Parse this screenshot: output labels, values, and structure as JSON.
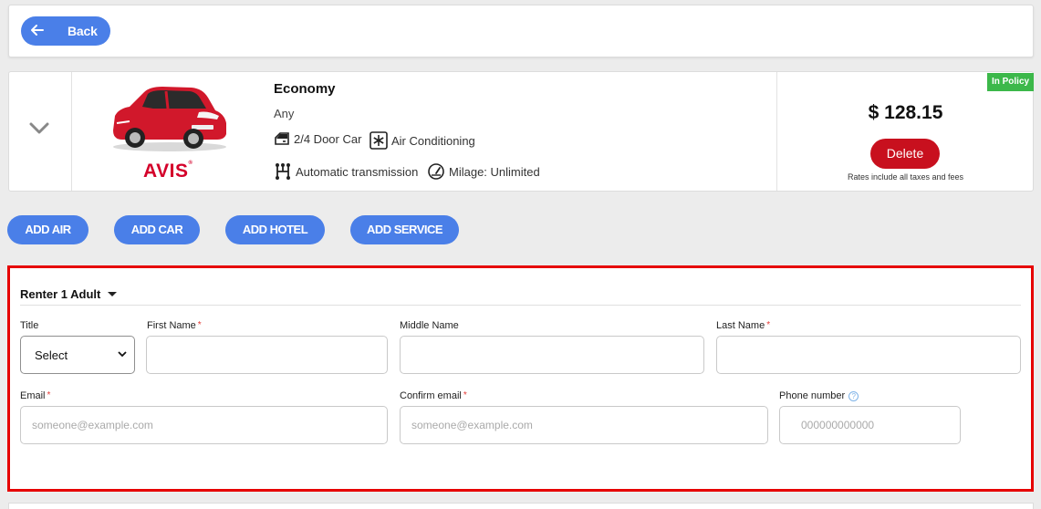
{
  "header": {
    "back_label": "Back"
  },
  "car": {
    "class": "Economy",
    "model": "Any",
    "vendor": "AVIS",
    "features": {
      "doors": "2/4 Door Car",
      "ac": "Air Conditioning",
      "transmission": "Automatic transmission",
      "mileage": "Milage: Unlimited"
    },
    "policy_badge": "In Policy",
    "price": "$ 128.15",
    "delete_label": "Delete",
    "fee_note": "Rates include all taxes and fees",
    "body_color": "#d1182b"
  },
  "add_buttons": {
    "air": "ADD AIR",
    "car": "ADD CAR",
    "hotel": "ADD HOTEL",
    "service": "ADD SERVICE"
  },
  "renter": {
    "title": "Renter 1 Adult",
    "fields": {
      "title_label": "Title",
      "title_value": "Select",
      "first_name_label": "First Name",
      "middle_name_label": "Middle Name",
      "last_name_label": "Last Name",
      "email_label": "Email",
      "email_placeholder": "someone@example.com",
      "confirm_email_label": "Confirm email",
      "confirm_email_placeholder": "someone@example.com",
      "phone_label": "Phone number",
      "phone_placeholder": "000000000000",
      "required_mark": "*",
      "help_mark": "?"
    }
  },
  "colors": {
    "primary_blue": "#4a7fe8",
    "danger_red": "#c8101e",
    "highlight_red": "#e60000",
    "policy_green": "#3cb84a"
  }
}
